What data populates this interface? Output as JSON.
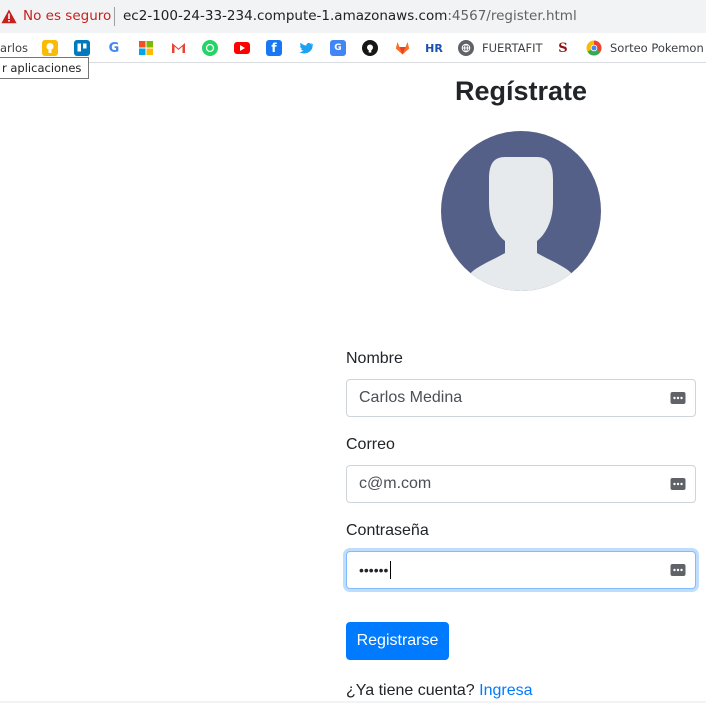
{
  "browser": {
    "security_label": "No es seguro",
    "url_main": "ec2-100-24-33-234.compute-1.amazonaws.com",
    "url_rest": ":4567/register.html",
    "bookmarks": [
      {
        "label": "arlos",
        "icon": "bookmark-carlos"
      },
      {
        "label": "",
        "icon": "google-keep-icon",
        "color": "#f9bb05"
      },
      {
        "label": "",
        "icon": "trello-icon",
        "color": "#0079bf"
      },
      {
        "label": "",
        "icon": "google-icon",
        "color": "#4285f4"
      },
      {
        "label": "",
        "icon": "microsoft-icon",
        "color": "#f25022"
      },
      {
        "label": "",
        "icon": "gmail-icon",
        "color": "#ea4335"
      },
      {
        "label": "",
        "icon": "whatsapp-icon",
        "color": "#25d366"
      },
      {
        "label": "",
        "icon": "youtube-icon",
        "color": "#ff0000"
      },
      {
        "label": "",
        "icon": "facebook-icon",
        "color": "#1877f2"
      },
      {
        "label": "",
        "icon": "twitter-icon",
        "color": "#1da1f2"
      },
      {
        "label": "",
        "icon": "google-translate-icon",
        "color": "#4285f4"
      },
      {
        "label": "",
        "icon": "github-icon",
        "color": "#181717"
      },
      {
        "label": "",
        "icon": "gitlab-icon",
        "color": "#fc6d26"
      },
      {
        "label": "",
        "icon": "hr-icon",
        "color": "#1a4fb4"
      },
      {
        "label": "FUERTAFIT",
        "icon": "globe-icon"
      },
      {
        "label": "",
        "icon": "stanford-icon",
        "color": "#8c1515"
      },
      {
        "label": "Sorteo Pokemon E",
        "icon": "chrome-icon"
      }
    ],
    "tooltip": "r aplicaciones"
  },
  "page": {
    "title": "Regístrate",
    "form": {
      "name_label": "Nombre",
      "name_value": "Carlos Medina",
      "email_label": "Correo",
      "email_value": "c@m.com",
      "password_label": "Contraseña",
      "password_mask": "••••••",
      "submit_label": "Registrarse",
      "login_prompt": "¿Ya tiene cuenta?",
      "login_link": "Ingresa"
    }
  },
  "colors": {
    "primary": "#007bff",
    "avatar_bg": "#546087",
    "avatar_fg": "#e6eaec",
    "warning": "#c5221f"
  }
}
